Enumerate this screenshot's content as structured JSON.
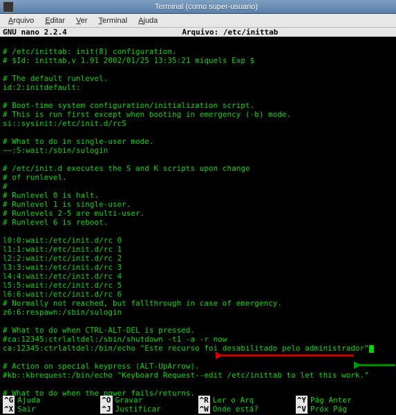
{
  "window": {
    "title": "Terminal (como super-usuario)"
  },
  "menubar": {
    "items": [
      {
        "label": "Arquivo",
        "ul": "A",
        "rest": "rquivo"
      },
      {
        "label": "Editar",
        "ul": "E",
        "rest": "ditar"
      },
      {
        "label": "Ver",
        "ul": "V",
        "rest": "er"
      },
      {
        "label": "Terminal",
        "ul": "T",
        "rest": "erminal"
      },
      {
        "label": "Ajuda",
        "ul": "A",
        "rest": "juda"
      }
    ]
  },
  "nano": {
    "version": "GNU nano 2.2.4",
    "file_label": "Arquivo: /etc/inittab"
  },
  "content": {
    "lines": [
      "",
      "# /etc/inittab: init(8) configuration.",
      "# $Id: inittab,v 1.91 2002/01/25 13:35:21 miquels Exp $",
      "",
      "# The default runlevel.",
      "id:2:initdefault:",
      "",
      "# Boot-time system configuration/initialization script.",
      "# This is run first except when booting in emergency (-b) mode.",
      "si::sysinit:/etc/init.d/rcS",
      "",
      "# What to do in single-user mode.",
      "~~:S:wait:/sbin/sulogin",
      "",
      "# /etc/init.d executes the S and K scripts upon change",
      "# of runlevel.",
      "#",
      "# Runlevel 0 is halt.",
      "# Runlevel 1 is single-user.",
      "# Runlevels 2-5 are multi-user.",
      "# Runlevel 6 is reboot.",
      "",
      "l0:0:wait:/etc/init.d/rc 0",
      "l1:1:wait:/etc/init.d/rc 1",
      "l2:2:wait:/etc/init.d/rc 2",
      "l3:3:wait:/etc/init.d/rc 3",
      "l4:4:wait:/etc/init.d/rc 4",
      "l5:5:wait:/etc/init.d/rc 5",
      "l6:6:wait:/etc/init.d/rc 6",
      "# Normally not reached, but fallthrough in case of emergency.",
      "z6:6:respawn:/sbin/sulogin",
      "",
      "# What to do when CTRL-ALT-DEL is pressed.",
      "#ca:12345:ctrlaltdel:/sbin/shutdown -t1 -a -r now",
      "ca:12345:ctrlaltdel:/bin/echo \"Este recurso foi desabilitado pelo administrador\"",
      "",
      "# Action on special keypress (ALT-UpArrow).",
      "#kb::kbrequest:/bin/echo \"Keyboard Request--edit /etc/inittab to let this work.\"",
      "",
      "# What to do when the power fails/returns."
    ],
    "cursor_line": 34
  },
  "footer": {
    "row1": [
      {
        "key": "^G",
        "label": "Ajuda"
      },
      {
        "key": "^O",
        "label": "Gravar"
      },
      {
        "key": "^R",
        "label": "Ler o Arq"
      },
      {
        "key": "^Y",
        "label": "Pág Anter"
      }
    ],
    "row2": [
      {
        "key": "^X",
        "label": "Sair"
      },
      {
        "key": "^J",
        "label": "Justificar"
      },
      {
        "key": "^W",
        "label": "Onde está?"
      },
      {
        "key": "^V",
        "label": "Próx Pág"
      }
    ]
  },
  "annotations": {
    "red_arrow": "highlight-commented-shutdown-line",
    "green_arrow": "highlight-new-echo-line"
  }
}
